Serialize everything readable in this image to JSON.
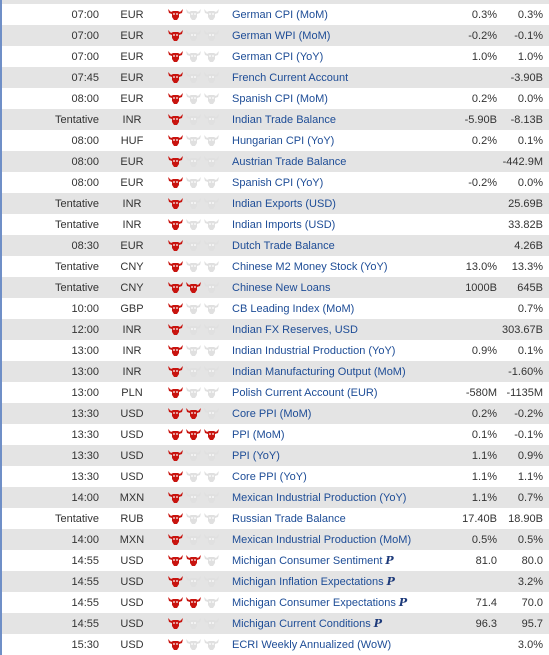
{
  "colors": {
    "bull_active": "#c8140f",
    "bull_inactive": "#e0e0e0",
    "event_link": "#1d4c96"
  },
  "rows": [
    {
      "time": "07:00",
      "currency": "EUR",
      "bulls": 1,
      "event": "German CPI (MoM)",
      "actual": "0.3%",
      "forecast": "0.3%"
    },
    {
      "time": "07:00",
      "currency": "EUR",
      "bulls": 1,
      "event": "German WPI (MoM)",
      "actual": "-0.2%",
      "forecast": "-0.1%"
    },
    {
      "time": "07:00",
      "currency": "EUR",
      "bulls": 1,
      "event": "German CPI (YoY)",
      "actual": "1.0%",
      "forecast": "1.0%"
    },
    {
      "time": "07:45",
      "currency": "EUR",
      "bulls": 1,
      "event": "French Current Account",
      "actual": "",
      "forecast": "-3.90B"
    },
    {
      "time": "08:00",
      "currency": "EUR",
      "bulls": 1,
      "event": "Spanish CPI (MoM)",
      "actual": "0.2%",
      "forecast": "0.0%"
    },
    {
      "time": "Tentative",
      "currency": "INR",
      "bulls": 1,
      "event": "Indian Trade Balance",
      "actual": "-5.90B",
      "forecast": "-8.13B"
    },
    {
      "time": "08:00",
      "currency": "HUF",
      "bulls": 1,
      "event": "Hungarian CPI (YoY)",
      "actual": "0.2%",
      "forecast": "0.1%"
    },
    {
      "time": "08:00",
      "currency": "EUR",
      "bulls": 1,
      "event": "Austrian Trade Balance",
      "actual": "",
      "forecast": "-442.9M"
    },
    {
      "time": "08:00",
      "currency": "EUR",
      "bulls": 1,
      "event": "Spanish CPI (YoY)",
      "actual": "-0.2%",
      "forecast": "0.0%"
    },
    {
      "time": "Tentative",
      "currency": "INR",
      "bulls": 1,
      "event": "Indian Exports (USD)",
      "actual": "",
      "forecast": "25.69B"
    },
    {
      "time": "Tentative",
      "currency": "INR",
      "bulls": 1,
      "event": "Indian Imports (USD)",
      "actual": "",
      "forecast": "33.82B"
    },
    {
      "time": "08:30",
      "currency": "EUR",
      "bulls": 1,
      "event": "Dutch Trade Balance",
      "actual": "",
      "forecast": "4.26B"
    },
    {
      "time": "Tentative",
      "currency": "CNY",
      "bulls": 1,
      "event": "Chinese M2 Money Stock (YoY)",
      "actual": "13.0%",
      "forecast": "13.3%"
    },
    {
      "time": "Tentative",
      "currency": "CNY",
      "bulls": 2,
      "event": "Chinese New Loans",
      "actual": "1000B",
      "forecast": "645B"
    },
    {
      "time": "10:00",
      "currency": "GBP",
      "bulls": 1,
      "event": "CB Leading Index (MoM)",
      "actual": "",
      "forecast": "0.7%"
    },
    {
      "time": "12:00",
      "currency": "INR",
      "bulls": 1,
      "event": "Indian FX Reserves, USD",
      "actual": "",
      "forecast": "303.67B"
    },
    {
      "time": "13:00",
      "currency": "INR",
      "bulls": 1,
      "event": "Indian Industrial Production (YoY)",
      "actual": "0.9%",
      "forecast": "0.1%"
    },
    {
      "time": "13:00",
      "currency": "INR",
      "bulls": 1,
      "event": "Indian Manufacturing Output (MoM)",
      "actual": "",
      "forecast": "-1.60%"
    },
    {
      "time": "13:00",
      "currency": "PLN",
      "bulls": 1,
      "event": "Polish Current Account (EUR)",
      "actual": "-580M",
      "forecast": "-1135M"
    },
    {
      "time": "13:30",
      "currency": "USD",
      "bulls": 2,
      "event": "Core PPI (MoM)",
      "actual": "0.2%",
      "forecast": "-0.2%"
    },
    {
      "time": "13:30",
      "currency": "USD",
      "bulls": 3,
      "event": "PPI (MoM)",
      "actual": "0.1%",
      "forecast": "-0.1%"
    },
    {
      "time": "13:30",
      "currency": "USD",
      "bulls": 1,
      "event": "PPI (YoY)",
      "actual": "1.1%",
      "forecast": "0.9%"
    },
    {
      "time": "13:30",
      "currency": "USD",
      "bulls": 1,
      "event": "Core PPI (YoY)",
      "actual": "1.1%",
      "forecast": "1.1%"
    },
    {
      "time": "14:00",
      "currency": "MXN",
      "bulls": 1,
      "event": "Mexican Industrial Production (YoY)",
      "actual": "1.1%",
      "forecast": "0.7%"
    },
    {
      "time": "Tentative",
      "currency": "RUB",
      "bulls": 1,
      "event": "Russian Trade Balance",
      "actual": "17.40B",
      "forecast": "18.90B"
    },
    {
      "time": "14:00",
      "currency": "MXN",
      "bulls": 1,
      "event": "Mexican Industrial Production (MoM)",
      "actual": "0.5%",
      "forecast": "0.5%"
    },
    {
      "time": "14:55",
      "currency": "USD",
      "bulls": 2,
      "event": "Michigan Consumer Sentiment",
      "prelim": "P",
      "actual": "81.0",
      "forecast": "80.0"
    },
    {
      "time": "14:55",
      "currency": "USD",
      "bulls": 1,
      "event": "Michigan Inflation Expectations",
      "prelim": "P",
      "actual": "",
      "forecast": "3.2%"
    },
    {
      "time": "14:55",
      "currency": "USD",
      "bulls": 2,
      "event": "Michigan Consumer Expectations",
      "prelim": "P",
      "actual": "71.4",
      "forecast": "70.0"
    },
    {
      "time": "14:55",
      "currency": "USD",
      "bulls": 1,
      "event": "Michigan Current Conditions",
      "prelim": "P",
      "actual": "96.3",
      "forecast": "95.7"
    },
    {
      "time": "15:30",
      "currency": "USD",
      "bulls": 1,
      "event": "ECRI Weekly Annualized (WoW)",
      "actual": "",
      "forecast": "3.0%"
    }
  ]
}
